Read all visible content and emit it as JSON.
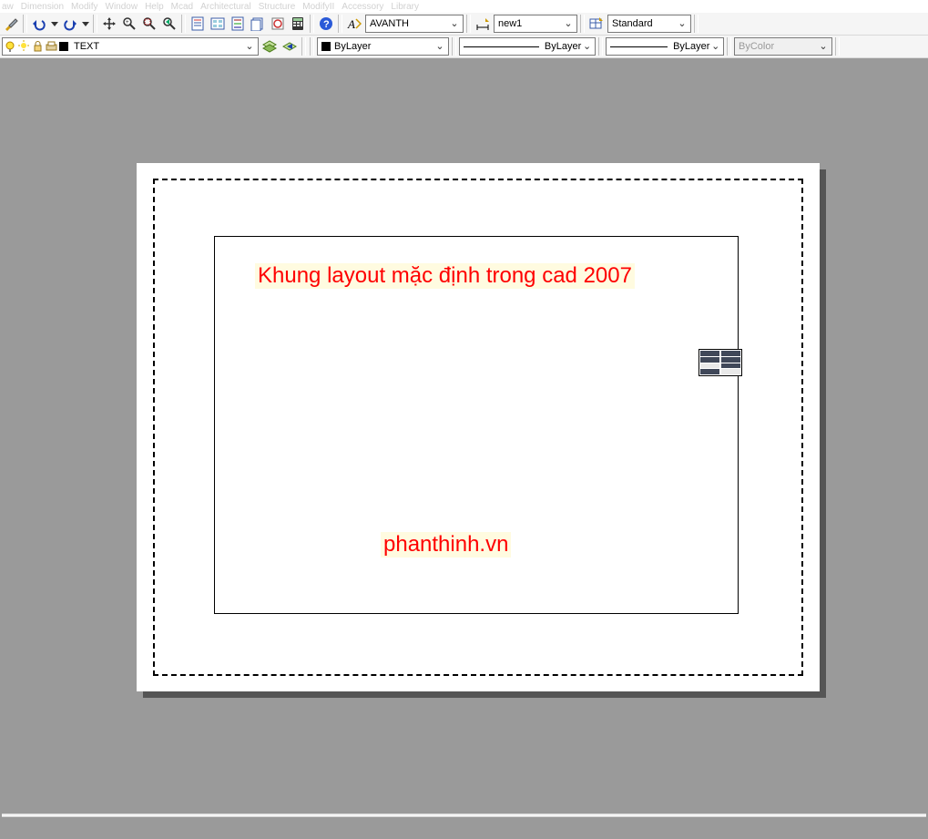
{
  "menu": {
    "items": [
      "aw",
      "Dimension",
      "Modify",
      "Window",
      "Help",
      "Mcad",
      "Architectural",
      "Structure",
      "ModifyII",
      "Accessory",
      "Library"
    ]
  },
  "toolbar1": {
    "style_font": "AVANTH",
    "dim_style": "new1",
    "table_style": "Standard"
  },
  "toolbar2": {
    "layer_name": "TEXT",
    "color_combo": "ByLayer",
    "linetype_combo": "ByLayer",
    "lineweight_combo": "ByLayer",
    "plotstyle": "ByColor"
  },
  "canvas": {
    "caption_main": "Khung layout mặc định trong cad 2007",
    "caption_watermark": "phanthinh.vn"
  }
}
